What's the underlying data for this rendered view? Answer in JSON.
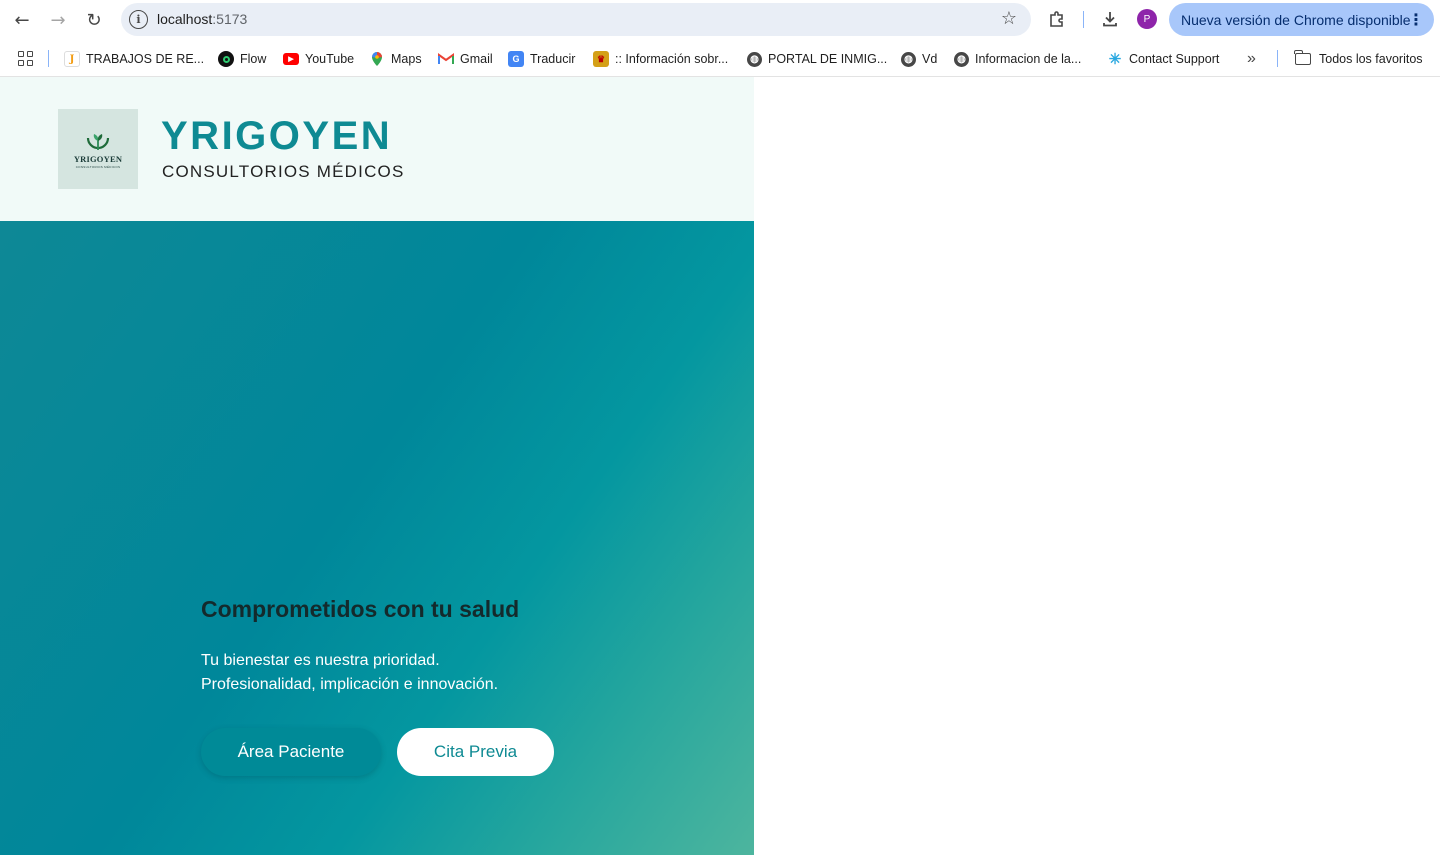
{
  "browser": {
    "url_host": "localhost",
    "url_port": ":5173",
    "update_label": "Nueva versión de Chrome disponible",
    "avatar_letter": "P",
    "icons": {
      "back": "arrow-back-icon",
      "forward": "arrow-forward-icon",
      "reload": "reload-icon",
      "site_info": "info-icon",
      "bookmark": "star-icon",
      "extensions": "puzzle-icon",
      "downloads": "download-icon",
      "menu": "kebab-menu-icon"
    },
    "colors": {
      "update_pill": "#a8c7fa",
      "avatar": "#8e24aa"
    }
  },
  "bookmarks": {
    "items": [
      {
        "label": "TRABAJOS DE RE...",
        "icon": "j-logo-icon"
      },
      {
        "label": "Flow",
        "icon": "flow-icon"
      },
      {
        "label": "YouTube",
        "icon": "youtube-icon"
      },
      {
        "label": "Maps",
        "icon": "maps-icon"
      },
      {
        "label": "Gmail",
        "icon": "gmail-icon"
      },
      {
        "label": "Traducir",
        "icon": "translate-icon"
      },
      {
        "label": ":: Información sobr...",
        "icon": "crest-icon"
      },
      {
        "label": "PORTAL DE INMIG...",
        "icon": "globe-icon"
      },
      {
        "label": "Vd",
        "icon": "globe-icon"
      },
      {
        "label": "Informacion de la...",
        "icon": "globe-icon"
      },
      {
        "label": "Contact Support",
        "icon": "sparkle-icon"
      }
    ],
    "more": "»",
    "all_bookmarks": "Todos los favoritos"
  },
  "site": {
    "logo": {
      "word": "YRIGOYEN",
      "sub": "CONSULTORIOS MÉDICOS"
    },
    "brand_name": "YRIGOYEN",
    "brand_tagline": "CONSULTORIOS MÉDICOS",
    "colors": {
      "brand": "#0e8a93",
      "header_bg": "#f1faf8",
      "hero_start": "#0e8896",
      "hero_end": "#4db59e"
    }
  },
  "hero": {
    "title": "Comprometidos con tu salud",
    "line1": "Tu bienestar es nuestra prioridad.",
    "line2": "Profesionalidad, implicación e innovación.",
    "btn_area": "Área Paciente",
    "btn_cita": "Cita Previa"
  }
}
